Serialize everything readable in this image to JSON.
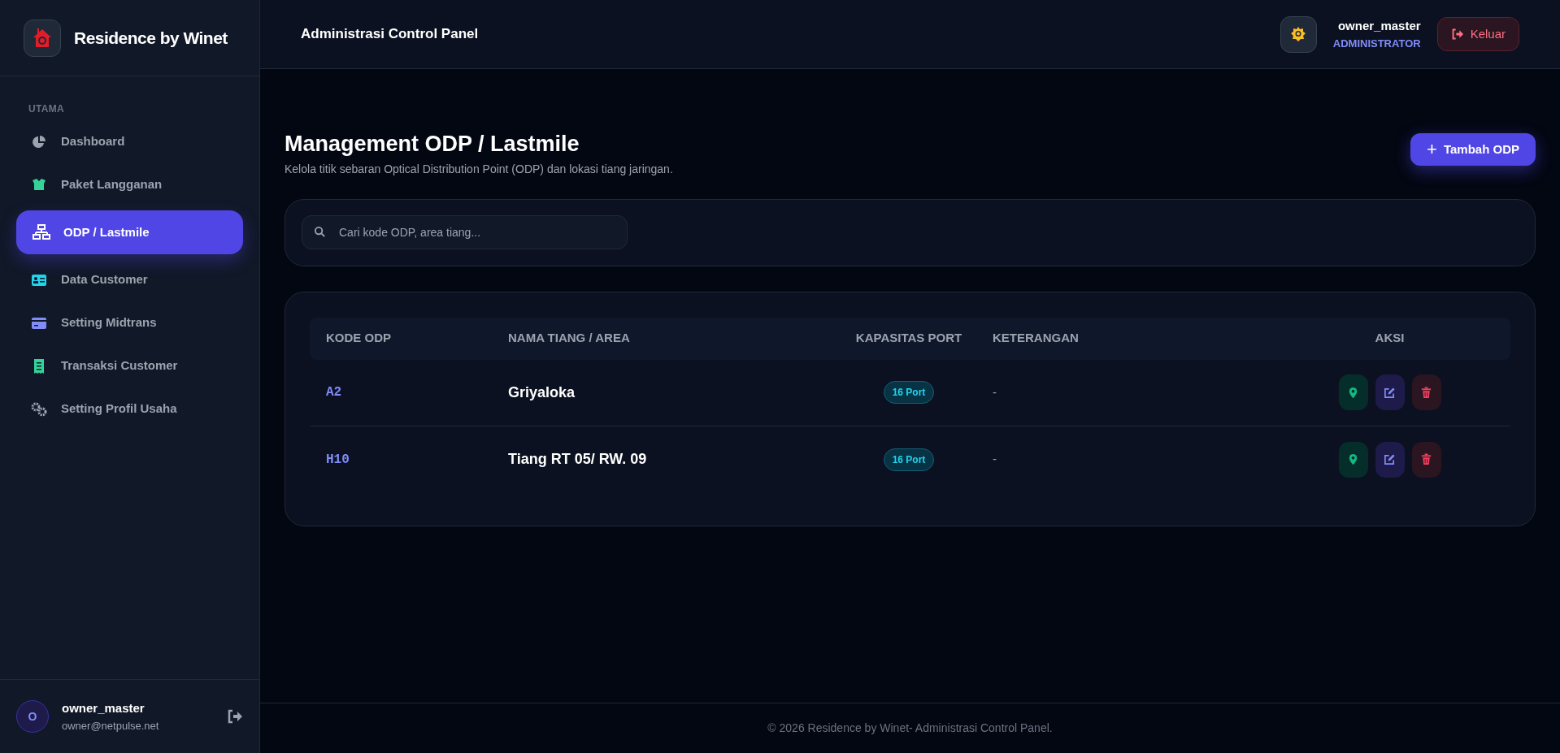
{
  "brand": {
    "name": "Residence by Winet"
  },
  "sidebar": {
    "section": "UTAMA",
    "items": [
      {
        "label": "Dashboard",
        "selected": false
      },
      {
        "label": "Paket Langganan",
        "selected": false
      },
      {
        "label": "ODP / Lastmile",
        "selected": true
      },
      {
        "label": "Data Customer",
        "selected": false
      },
      {
        "label": "Setting Midtrans",
        "selected": false
      },
      {
        "label": "Transaksi Customer",
        "selected": false
      },
      {
        "label": "Setting Profil Usaha",
        "selected": false
      }
    ],
    "user": {
      "avatar": "O",
      "name": "owner_master",
      "email": "owner@netpulse.net"
    }
  },
  "header": {
    "title": "Administrasi Control Panel",
    "user": "owner_master",
    "role": "ADMINISTRATOR",
    "logout": "Keluar"
  },
  "page": {
    "title": "Management ODP / Lastmile",
    "subtitle": "Kelola titik sebaran Optical Distribution Point (ODP) dan lokasi tiang jaringan.",
    "add_button": "Tambah ODP",
    "add_icon": "+"
  },
  "search": {
    "placeholder": "Cari kode ODP, area tiang..."
  },
  "table": {
    "columns": [
      "KODE ODP",
      "NAMA TIANG / AREA",
      "KAPASITAS PORT",
      "KETERANGAN",
      "AKSI"
    ],
    "rows": [
      {
        "code": "A2",
        "name": "Griyaloka",
        "capacity": "16 Port",
        "note": "-"
      },
      {
        "code": "H10",
        "name": "Tiang RT 05/ RW. 09",
        "capacity": "16 Port",
        "note": "-"
      }
    ]
  },
  "footer": "© 2026 Residence by Winet- Administrasi Control Panel."
}
